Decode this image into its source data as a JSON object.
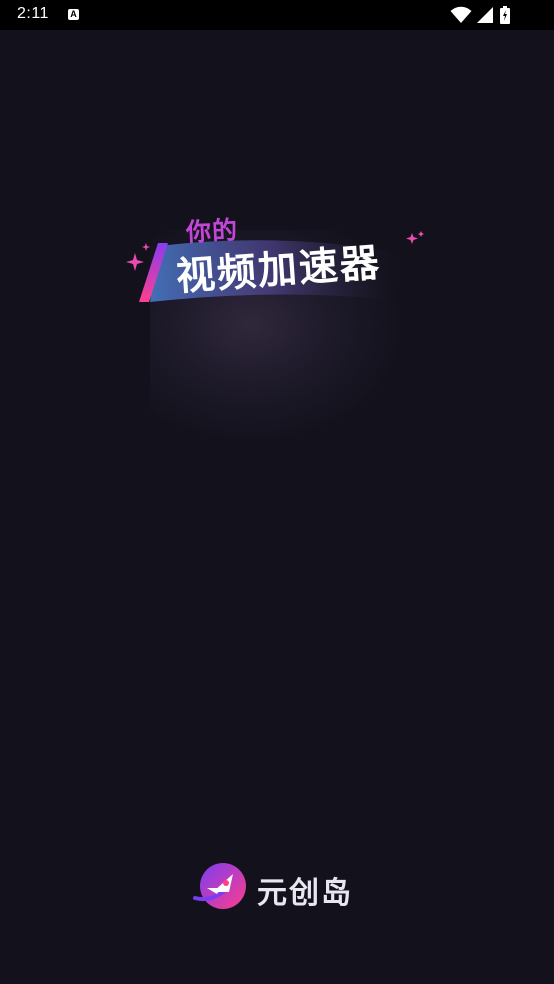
{
  "status_bar": {
    "time": "2:11",
    "notification_letter": "A",
    "icons": [
      "wifi-icon",
      "signal-icon",
      "battery-icon"
    ]
  },
  "splash": {
    "tagline_small": "你的",
    "tagline_large": "视频加速器",
    "colors": {
      "background": "#13121c",
      "accent_pink": "#e93a9a",
      "accent_purple": "#8a3cf0"
    }
  },
  "brand": {
    "name": "元创岛",
    "logo_icon": "rocket-logo-icon"
  }
}
